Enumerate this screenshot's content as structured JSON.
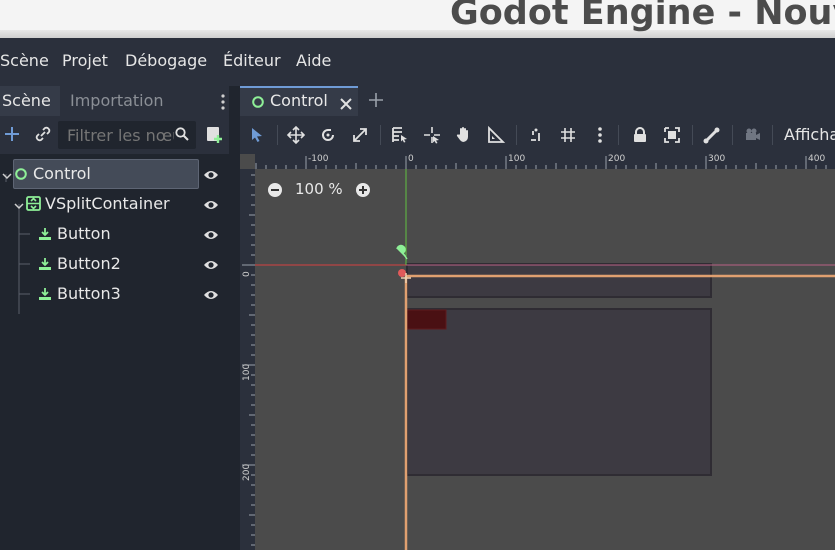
{
  "window": {
    "title": "Godot Engine - Nouv"
  },
  "menu": {
    "items": [
      "Scène",
      "Projet",
      "Débogage",
      "Éditeur",
      "Aide"
    ]
  },
  "dock": {
    "tabs": {
      "scene": "Scène",
      "import": "Importation"
    },
    "filter": {
      "placeholder": "Filtrer les nœuds"
    }
  },
  "tree": {
    "nodes": [
      {
        "name": "Control",
        "type": "Control"
      },
      {
        "name": "VSplitContainer",
        "type": "VSplitContainer"
      },
      {
        "name": "Button",
        "type": "Button"
      },
      {
        "name": "Button2",
        "type": "Button"
      },
      {
        "name": "Button3",
        "type": "Button"
      }
    ]
  },
  "editor": {
    "tab_label": "Control",
    "toolbar": {
      "view_menu": "Afficha"
    },
    "zoom": {
      "value": "100 %"
    },
    "ruler": {
      "h_ticks": [
        "-100",
        "0",
        "100",
        "200",
        "300",
        "400"
      ],
      "v_ticks": [
        "0",
        "100",
        "200"
      ]
    }
  },
  "colors": {
    "accent": "#6f9bd6",
    "node_green": "#8eef97",
    "selection_orange": "#e0a070",
    "axis_red": "#d64040",
    "axis_green": "#60c040"
  }
}
